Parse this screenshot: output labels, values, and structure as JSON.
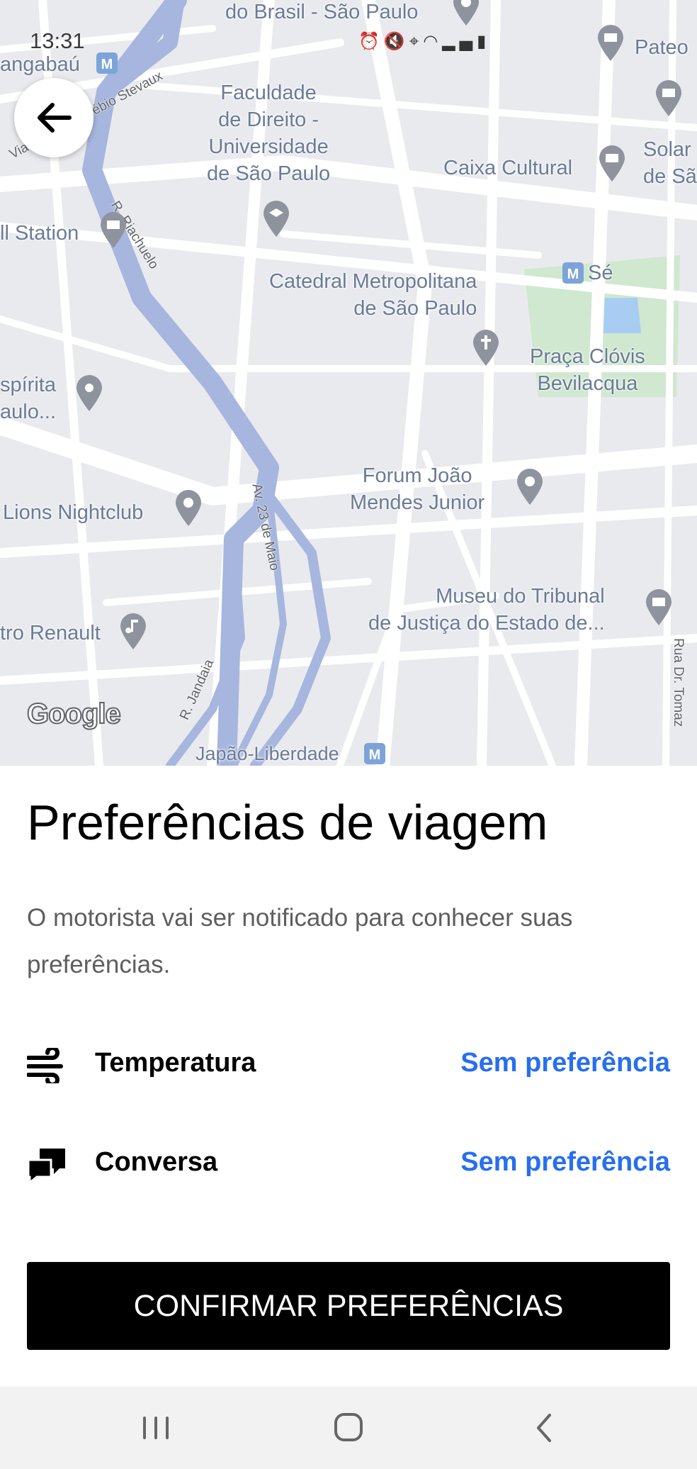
{
  "status_bar": {
    "time": "13:31",
    "icons": [
      "alarm-icon",
      "mute-icon",
      "location-icon",
      "wifi-icon",
      "signal-icon",
      "battery-icon"
    ]
  },
  "map": {
    "labels": {
      "brasil_sp": "do Brasil - São Paulo",
      "anhangabau": "angabaú",
      "faculdade": "Faculdade\nde Direito -\nUniversidade\nde São Paulo",
      "caixa": "Caixa Cultural",
      "pateo": "Pateo",
      "solar": "Solar\nde Sã",
      "station": "ll Station",
      "catedral": "Catedral Metropolitana\nde São Paulo",
      "se": "Sé",
      "praca": "Praça Clóvis\nBevilacqua",
      "espirita": "spírita\naulo...",
      "forum": "Forum João\nMendes Junior",
      "lions": "Lions Nightclub",
      "museu": "Museu do Tribunal\nde Justiça do Estado de...",
      "renault": "tro Renault",
      "japao": "Japão-Liberdade",
      "viaduto": "Viaduto Dr. Eusébio Stevaux",
      "riachuelo": "R. Riachuelo",
      "av23": "Av. 23 de Maio",
      "jandaia": "R. Jandaia",
      "tomaz": "Rua Dr. Tomaz"
    },
    "google_logo": "Google"
  },
  "sheet": {
    "title": "Preferências de viagem",
    "description": "O motorista vai ser notificado para conhecer suas preferências.",
    "preferences": [
      {
        "label": "Temperatura",
        "value": "Sem preferência",
        "icon": "wind-icon"
      },
      {
        "label": "Conversa",
        "value": "Sem preferência",
        "icon": "chat-icon"
      }
    ],
    "confirm_label": "CONFIRMAR PREFERÊNCIAS"
  },
  "colors": {
    "accent_link": "#276ef1",
    "button_bg": "#000000",
    "map_bg": "#e9eaee",
    "highway": "#a6b6de",
    "park": "#cfe8cf"
  }
}
